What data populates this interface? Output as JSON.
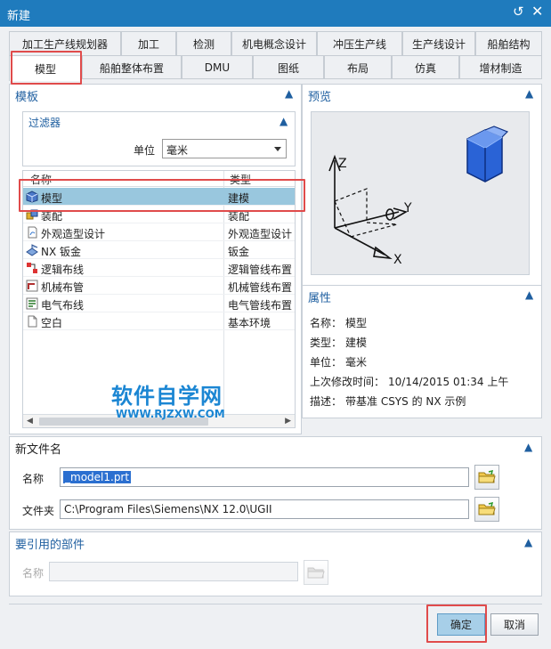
{
  "window": {
    "title": "新建"
  },
  "tabs_row1": [
    "加工生产线规划器",
    "加工",
    "检测",
    "机电概念设计",
    "冲压生产线",
    "生产线设计",
    "船舶结构"
  ],
  "tabs_row2": [
    "模型",
    "船舶整体布置",
    "DMU",
    "图纸",
    "布局",
    "仿真",
    "增材制造"
  ],
  "active_tab": "模型",
  "templates": {
    "title": "模板",
    "filter": {
      "title": "过滤器",
      "unit_label": "单位",
      "unit_value": "毫米"
    },
    "columns": [
      "名称",
      "类型"
    ],
    "rows": [
      {
        "name": "模型",
        "type": "建模",
        "icon": "model-icon",
        "selected": true
      },
      {
        "name": "装配",
        "type": "装配",
        "icon": "assembly-icon"
      },
      {
        "name": "外观造型设计",
        "type": "外观造型设计",
        "icon": "shape-studio-icon"
      },
      {
        "name": "NX 钣金",
        "type": "钣金",
        "icon": "sheet-metal-icon"
      },
      {
        "name": "逻辑布线",
        "type": "逻辑管线布置",
        "icon": "logical-routing-icon"
      },
      {
        "name": "机械布管",
        "type": "机械管线布置",
        "icon": "mechanical-routing-icon"
      },
      {
        "name": "电气布线",
        "type": "电气管线布置",
        "icon": "electrical-routing-icon"
      },
      {
        "name": "空白",
        "type": "基本环境",
        "icon": "blank-icon"
      }
    ]
  },
  "preview": {
    "title": "预览",
    "axis_x": "X",
    "axis_y": "Y",
    "axis_z": "Z"
  },
  "properties": {
    "title": "属性",
    "items": [
      {
        "label": "名称：",
        "value": "模型"
      },
      {
        "label": "类型：",
        "value": "建模"
      },
      {
        "label": "单位：",
        "value": "毫米"
      },
      {
        "label": "上次修改时间：",
        "value": "10/14/2015 01:34 上午"
      },
      {
        "label": "描述：",
        "value": "带基准 CSYS 的 NX 示例"
      }
    ]
  },
  "new_file": {
    "title": "新文件名",
    "name_label": "名称",
    "name_value": "_model1.prt",
    "folder_label": "文件夹",
    "folder_value": "C:\\Program Files\\Siemens\\NX 12.0\\UGII"
  },
  "referenced_parts": {
    "title": "要引用的部件",
    "name_label": "名称"
  },
  "buttons": {
    "ok": "确定",
    "cancel": "取消"
  },
  "watermark": {
    "main": "软件自学网",
    "sub": "WWW.RJZXW.COM"
  }
}
